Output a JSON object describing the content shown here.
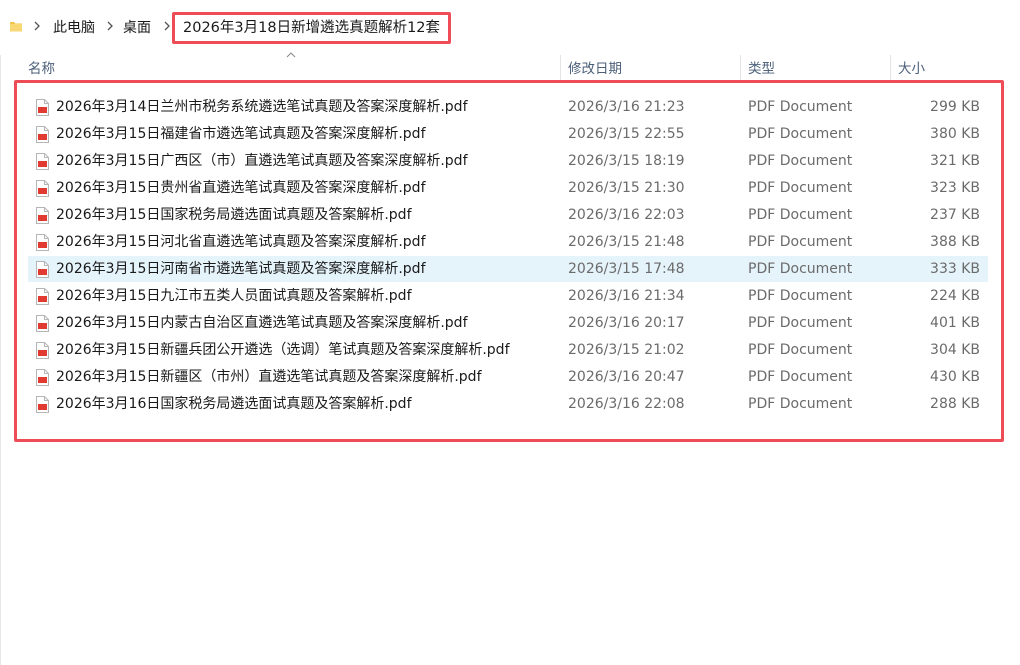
{
  "breadcrumb": {
    "items": [
      "此电脑",
      "桌面",
      "2026年3月18日新增遴选真题解析12套"
    ]
  },
  "columns": {
    "name": "名称",
    "modified": "修改日期",
    "type": "类型",
    "size": "大小"
  },
  "files": [
    {
      "name": "2026年3月14日兰州市税务系统遴选笔试真题及答案深度解析.pdf",
      "modified": "2026/3/16 21:23",
      "type": "PDF Document",
      "size": "299 KB"
    },
    {
      "name": "2026年3月15日福建省市遴选笔试真题及答案深度解析.pdf",
      "modified": "2026/3/15 22:55",
      "type": "PDF Document",
      "size": "380 KB"
    },
    {
      "name": "2026年3月15日广西区（市）直遴选笔试真题及答案深度解析.pdf",
      "modified": "2026/3/15 18:19",
      "type": "PDF Document",
      "size": "321 KB"
    },
    {
      "name": "2026年3月15日贵州省直遴选笔试真题及答案深度解析.pdf",
      "modified": "2026/3/15 21:30",
      "type": "PDF Document",
      "size": "323 KB"
    },
    {
      "name": "2026年3月15日国家税务局遴选面试真题及答案解析.pdf",
      "modified": "2026/3/16 22:03",
      "type": "PDF Document",
      "size": "237 KB"
    },
    {
      "name": "2026年3月15日河北省直遴选笔试真题及答案深度解析.pdf",
      "modified": "2026/3/15 21:48",
      "type": "PDF Document",
      "size": "388 KB"
    },
    {
      "name": "2026年3月15日河南省市遴选笔试真题及答案深度解析.pdf",
      "modified": "2026/3/15 17:48",
      "type": "PDF Document",
      "size": "333 KB"
    },
    {
      "name": "2026年3月15日九江市五类人员面试真题及答案解析.pdf",
      "modified": "2026/3/16 21:34",
      "type": "PDF Document",
      "size": "224 KB"
    },
    {
      "name": "2026年3月15日内蒙古自治区直遴选笔试真题及答案深度解析.pdf",
      "modified": "2026/3/16 20:17",
      "type": "PDF Document",
      "size": "401 KB"
    },
    {
      "name": "2026年3月15日新疆兵团公开遴选（选调）笔试真题及答案深度解析.pdf",
      "modified": "2026/3/15 21:02",
      "type": "PDF Document",
      "size": "304 KB"
    },
    {
      "name": "2026年3月15日新疆区（市州）直遴选笔试真题及答案深度解析.pdf",
      "modified": "2026/3/16 20:47",
      "type": "PDF Document",
      "size": "430 KB"
    },
    {
      "name": "2026年3月16日国家税务局遴选面试真题及答案解析.pdf",
      "modified": "2026/3/16 22:08",
      "type": "PDF Document",
      "size": "288 KB"
    }
  ],
  "selected_index": 6,
  "colors": {
    "highlight_border": "#ee4d57",
    "selected_row": "#e5f3fb",
    "header_text": "#4c607a",
    "folder": "#f3c64a",
    "pdf_icon": "#e03a31"
  },
  "icons": {
    "folder": "folder-icon",
    "separator": "chevron-right-icon",
    "file": "pdf-file-icon",
    "sort": "sort-up-icon"
  }
}
